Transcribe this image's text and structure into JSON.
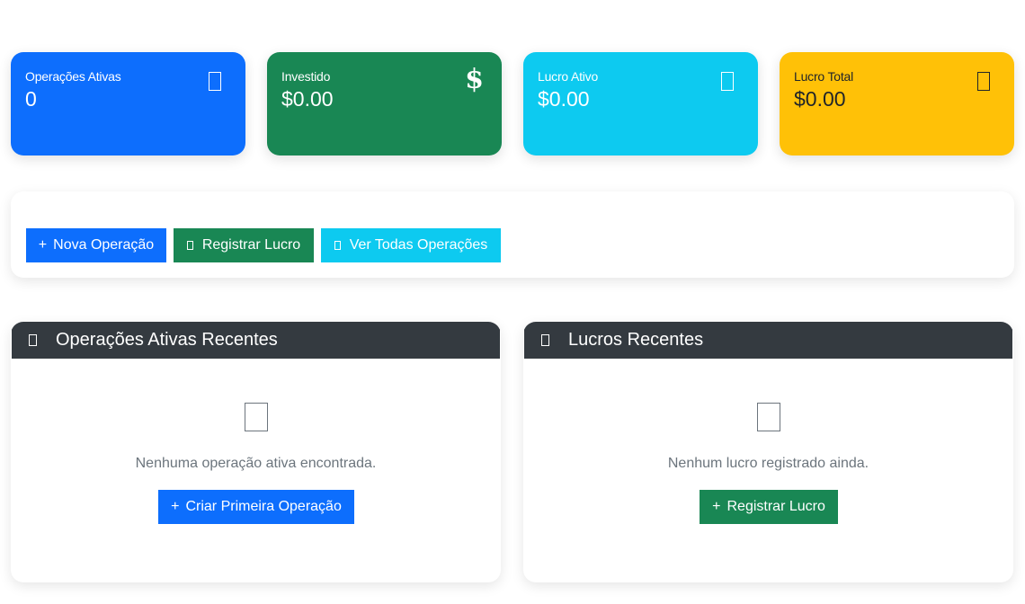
{
  "stats": {
    "active_ops": {
      "label": "Operações Ativas",
      "value": "0",
      "icon": "briefcase-icon",
      "color": "#0d6efd"
    },
    "invested": {
      "label": "Investido",
      "value": "$0.00",
      "icon": "dollar-icon",
      "icon_glyph": "$",
      "color": "#198754"
    },
    "active_profit": {
      "label": "Lucro Ativo",
      "value": "$0.00",
      "icon": "chart-icon",
      "color": "#0dcaf0"
    },
    "total_profit": {
      "label": "Lucro Total",
      "value": "$0.00",
      "icon": "trophy-icon",
      "color": "#ffc107"
    }
  },
  "actions": {
    "new_operation": {
      "glyph": "+",
      "label": "Nova Operação"
    },
    "register_profit": {
      "label": "Registrar Lucro"
    },
    "view_all": {
      "label": "Ver Todas Operações"
    }
  },
  "recent_ops": {
    "title": "Operações Ativas Recentes",
    "empty_text": "Nenhuma operação ativa encontrada.",
    "button": {
      "glyph": "+",
      "label": "Criar Primeira Operação"
    }
  },
  "recent_profits": {
    "title": "Lucros Recentes",
    "empty_text": "Nenhum lucro registrado ainda.",
    "button": {
      "glyph": "+",
      "label": "Registrar Lucro"
    }
  }
}
